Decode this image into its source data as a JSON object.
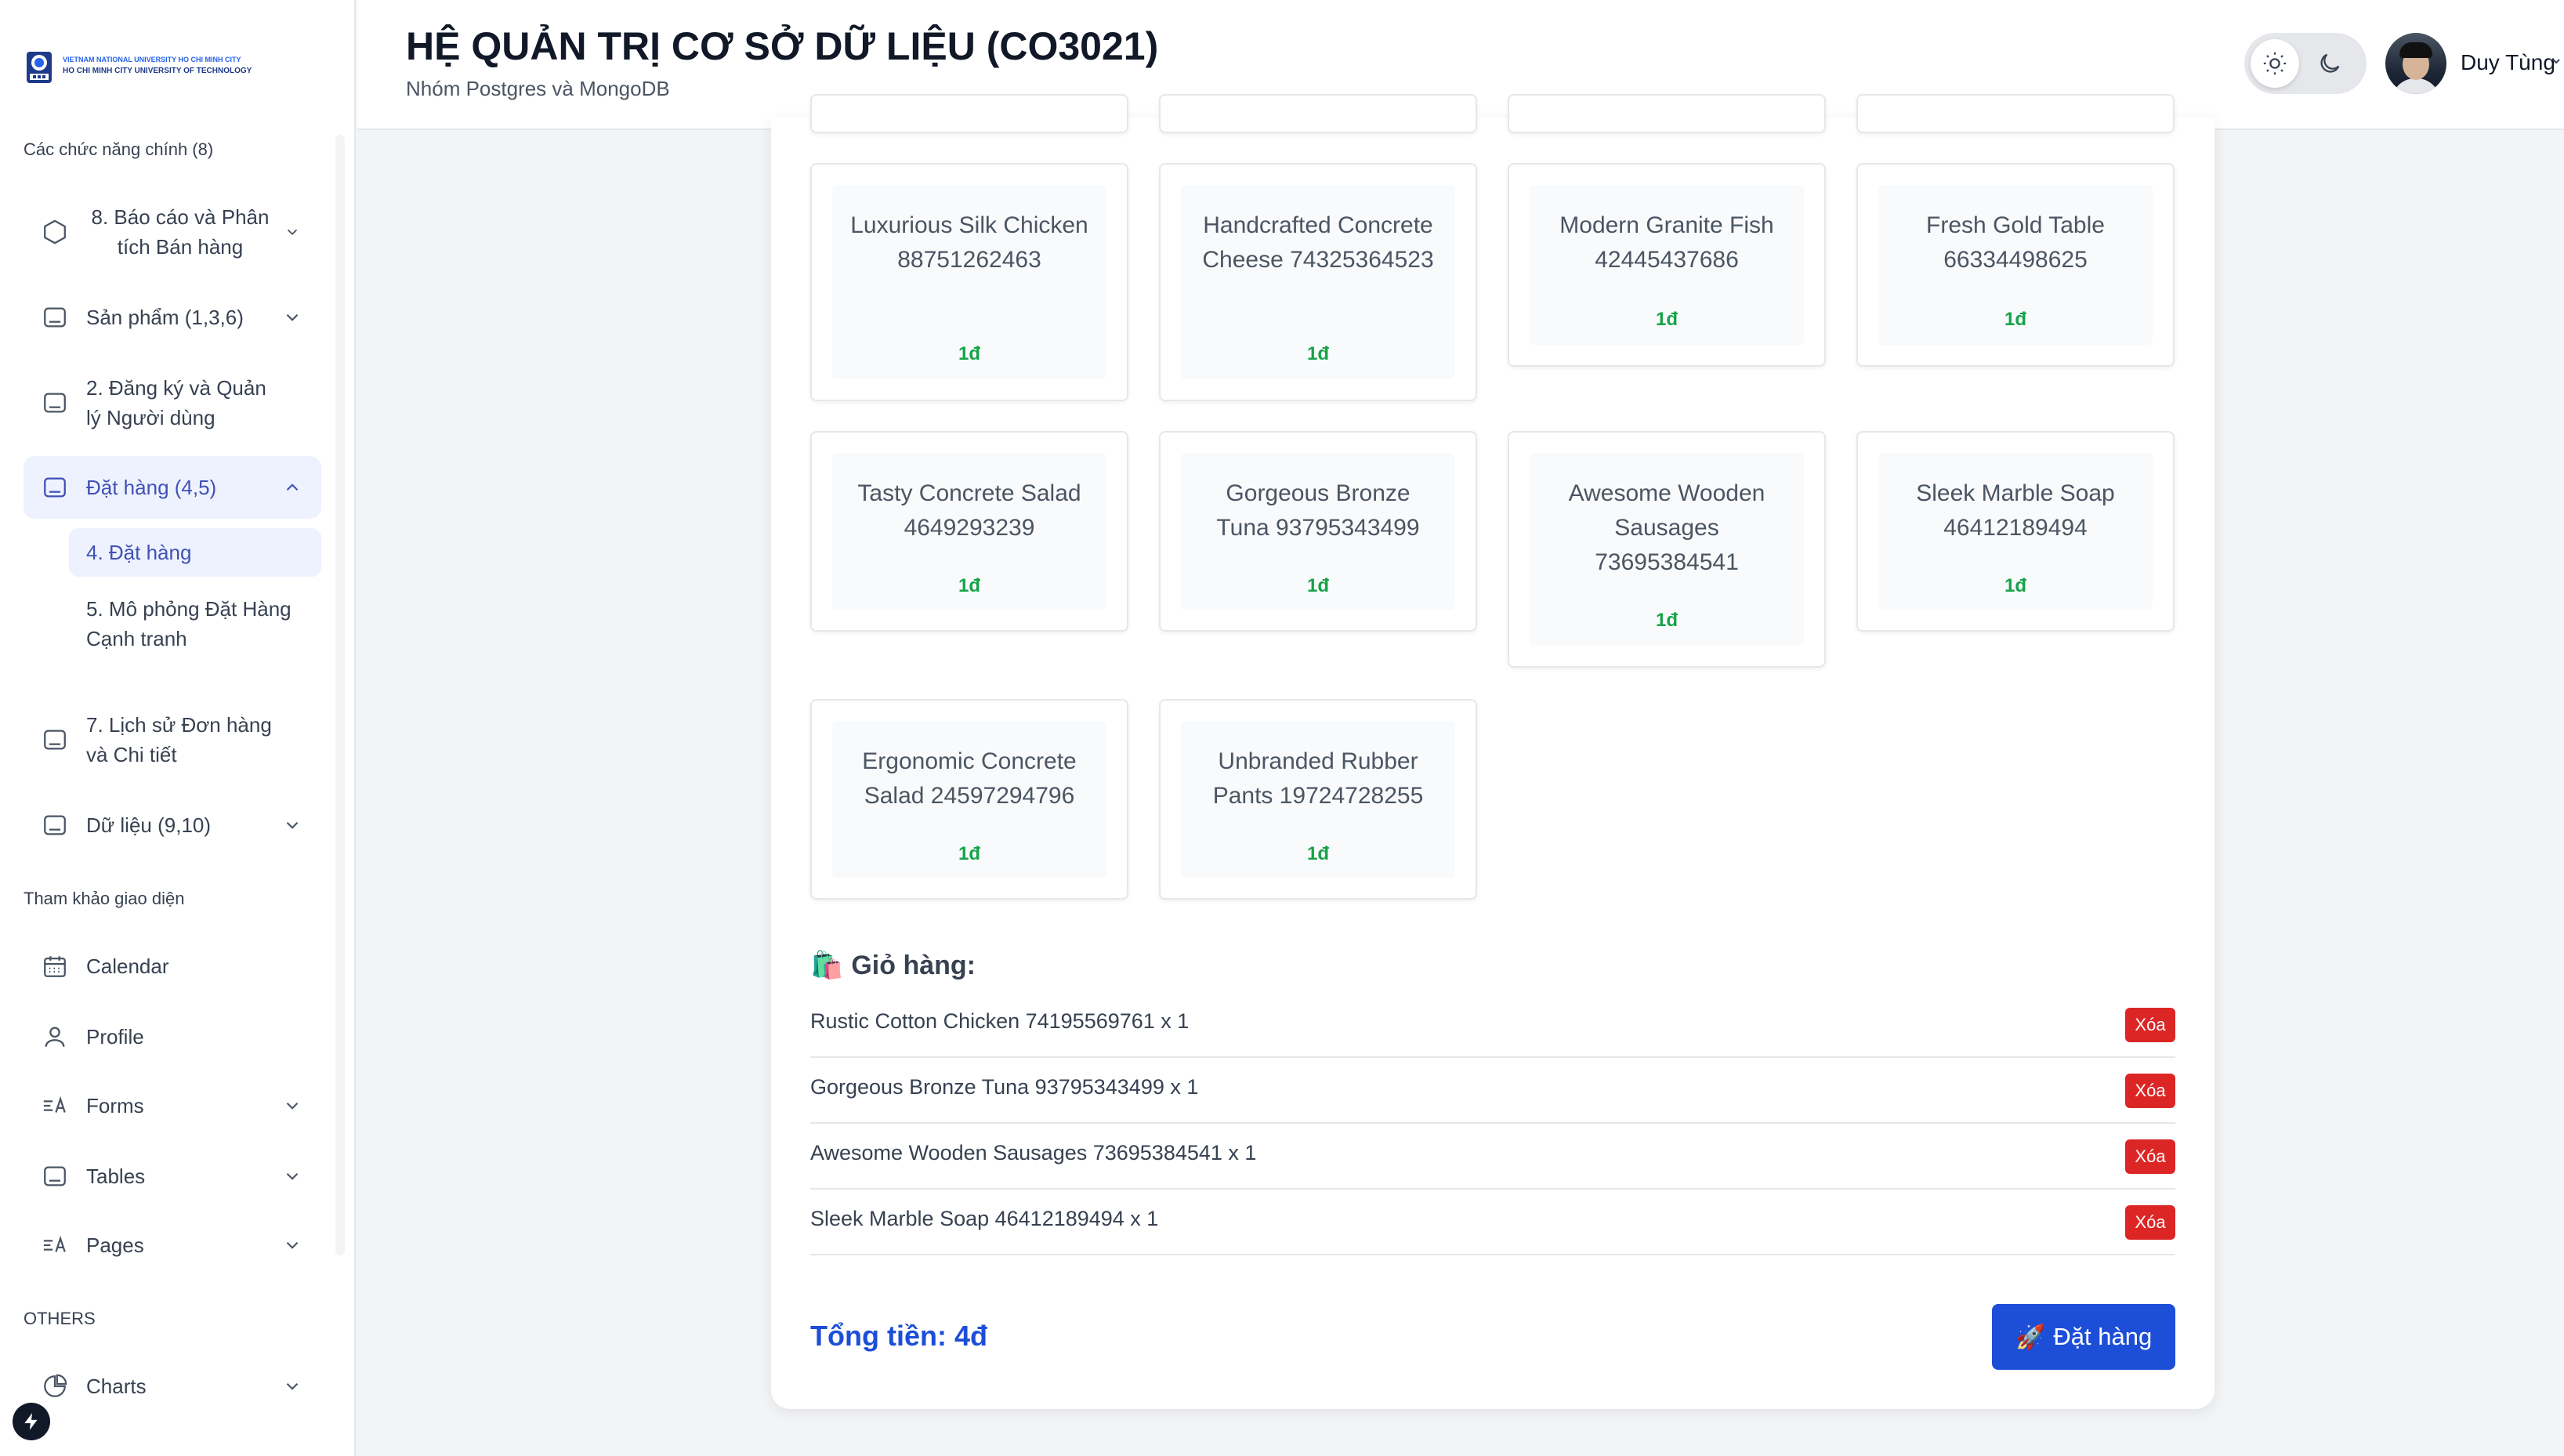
{
  "logo": {
    "line1": "VIETNAM NATIONAL UNIVERSITY HO CHI MINH CITY",
    "line2": "HO CHI MINH CITY UNIVERSITY OF TECHNOLOGY"
  },
  "sidebar": {
    "section_main": "Các chức năng chính (8)",
    "items": [
      {
        "label": "8. Báo cáo và Phân tích Bán hàng",
        "icon": "box-icon"
      },
      {
        "label": "Sản phẩm (1,3,6)",
        "icon": "table-icon"
      },
      {
        "label": "2. Đăng ký và Quản lý Người dùng",
        "icon": "table-icon"
      },
      {
        "label": "Đặt hàng (4,5)",
        "icon": "table-icon"
      },
      {
        "label": "7. Lịch sử Đơn hàng và Chi tiết",
        "icon": "table-icon"
      },
      {
        "label": "Dữ liệu (9,10)",
        "icon": "table-icon"
      }
    ],
    "sub_items": [
      {
        "label": "4. Đặt hàng"
      },
      {
        "label": "5. Mô phỏng Đặt Hàng Cạnh tranh"
      }
    ],
    "section_ref": "Tham khảo giao diện",
    "ref_items": [
      {
        "label": "Calendar",
        "icon": "calendar-icon"
      },
      {
        "label": "Profile",
        "icon": "user-icon"
      },
      {
        "label": "Forms",
        "icon": "forms-icon"
      },
      {
        "label": "Tables",
        "icon": "table-icon"
      },
      {
        "label": "Pages",
        "icon": "pages-icon"
      }
    ],
    "section_others": "OTHERS",
    "other_items": [
      {
        "label": "Charts",
        "icon": "pie-chart-icon"
      }
    ]
  },
  "header": {
    "title": "HỆ QUẢN TRỊ CƠ SỞ DỮ LIỆU (CO3021)",
    "subtitle": "Nhóm Postgres và MongoDB",
    "user_name": "Duy Tùng"
  },
  "products": [
    {
      "name": "Luxurious Silk Chicken 88751262463",
      "price": "1đ"
    },
    {
      "name": "Handcrafted Concrete Cheese 74325364523",
      "price": "1đ"
    },
    {
      "name": "Modern Granite Fish 42445437686",
      "price": "1đ"
    },
    {
      "name": "Fresh Gold Table 66334498625",
      "price": "1đ"
    },
    {
      "name": "Tasty Concrete Salad 4649293239",
      "price": "1đ"
    },
    {
      "name": "Gorgeous Bronze Tuna 93795343499",
      "price": "1đ"
    },
    {
      "name": "Awesome Wooden Sausages 73695384541",
      "price": "1đ"
    },
    {
      "name": "Sleek Marble Soap 46412189494",
      "price": "1đ"
    },
    {
      "name": "Ergonomic Concrete Salad 24597294796",
      "price": "1đ"
    },
    {
      "name": "Unbranded Rubber Pants 19724728255",
      "price": "1đ"
    }
  ],
  "cart": {
    "emoji": "🛍️",
    "title": "Giỏ hàng:",
    "items": [
      {
        "text": "Rustic Cotton Chicken 74195569761 x 1",
        "remove_label": "Xóa"
      },
      {
        "text": "Gorgeous Bronze Tuna 93795343499 x 1",
        "remove_label": "Xóa"
      },
      {
        "text": "Awesome Wooden Sausages 73695384541 x 1",
        "remove_label": "Xóa"
      },
      {
        "text": "Sleek Marble Soap 46412189494 x 1",
        "remove_label": "Xóa"
      }
    ],
    "total": "Tổng tiền: 4đ",
    "order_emoji": "🚀",
    "order_label": "Đặt hàng"
  },
  "colors": {
    "accent": "#3f51b5",
    "primary_button": "#1d4ed8",
    "danger": "#dc2626",
    "price": "#16a34a"
  }
}
